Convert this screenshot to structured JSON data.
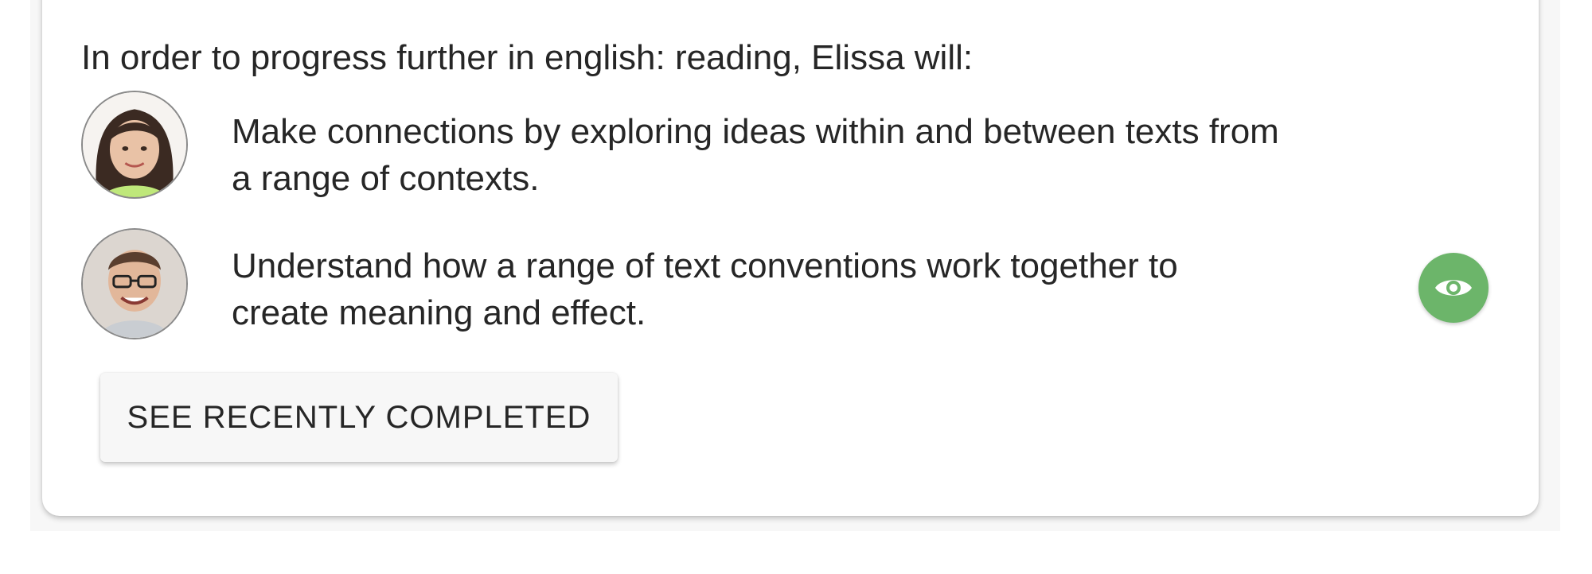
{
  "intro_text": "In order to progress further in english: reading, Elissa will:",
  "goals": [
    {
      "line1": "Make connections by exploring ideas within and between texts from",
      "line2": "a range of contexts.",
      "avatar": "student-avatar"
    },
    {
      "line1": "Understand how a range of text conventions work together to",
      "line2": "create meaning and effect.",
      "avatar": "teacher-avatar"
    }
  ],
  "see_button_label": "SEE RECENTLY COMPLETED",
  "view_icon": "eye-icon",
  "colors": {
    "accent_green": "#6cb56a",
    "text": "#262626",
    "button_bg": "#f7f7f7"
  }
}
